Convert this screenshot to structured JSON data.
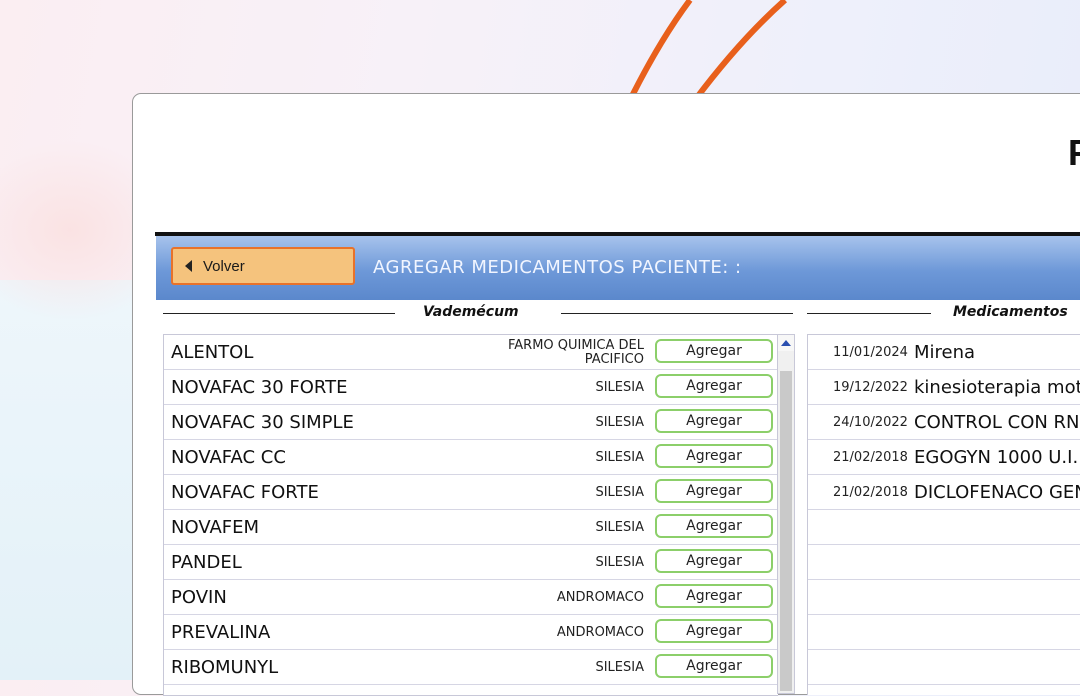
{
  "header": {
    "partial_title_letter": "F",
    "back_label": "Volver",
    "title": "AGREGAR MEDICAMENTOS PACIENTE: :"
  },
  "sections": {
    "left_title": "Vademécum",
    "right_title": "Medicamentos"
  },
  "vademecum": [
    {
      "name": "ALENTOL",
      "lab": "FARMO QUIMICA DEL PACIFICO",
      "action": "Agregar"
    },
    {
      "name": "NOVAFAC 30 FORTE",
      "lab": "SILESIA",
      "action": "Agregar"
    },
    {
      "name": "NOVAFAC 30 SIMPLE",
      "lab": "SILESIA",
      "action": "Agregar"
    },
    {
      "name": "NOVAFAC CC",
      "lab": "SILESIA",
      "action": "Agregar"
    },
    {
      "name": "NOVAFAC FORTE",
      "lab": "SILESIA",
      "action": "Agregar"
    },
    {
      "name": "NOVAFEM",
      "lab": "SILESIA",
      "action": "Agregar"
    },
    {
      "name": "PANDEL",
      "lab": "SILESIA",
      "action": "Agregar"
    },
    {
      "name": "POVIN",
      "lab": "ANDROMACO",
      "action": "Agregar"
    },
    {
      "name": "PREVALINA",
      "lab": "ANDROMACO",
      "action": "Agregar"
    },
    {
      "name": "RIBOMUNYL",
      "lab": "SILESIA",
      "action": "Agregar"
    }
  ],
  "medicamentos": [
    {
      "date": "11/01/2024",
      "name": "Mirena"
    },
    {
      "date": "19/12/2022",
      "name": "kinesioterapia moto"
    },
    {
      "date": "24/10/2022",
      "name": "CONTROL CON RN"
    },
    {
      "date": "21/02/2018",
      "name": "EGOGYN 1000 U.I."
    },
    {
      "date": "21/02/2018",
      "name": "DICLOFENACO GEN"
    },
    {
      "date": "",
      "name": ""
    },
    {
      "date": "",
      "name": ""
    },
    {
      "date": "",
      "name": ""
    },
    {
      "date": "",
      "name": ""
    },
    {
      "date": "",
      "name": ""
    }
  ],
  "colors": {
    "accent_orange": "#e8722a",
    "back_button_fill": "#f5c37d",
    "header_blue": "#6d98d8",
    "add_button_border": "#8ccf6a"
  },
  "icons": {
    "back": "caret-left-icon",
    "scroll_up": "scroll-up-arrow-icon"
  }
}
